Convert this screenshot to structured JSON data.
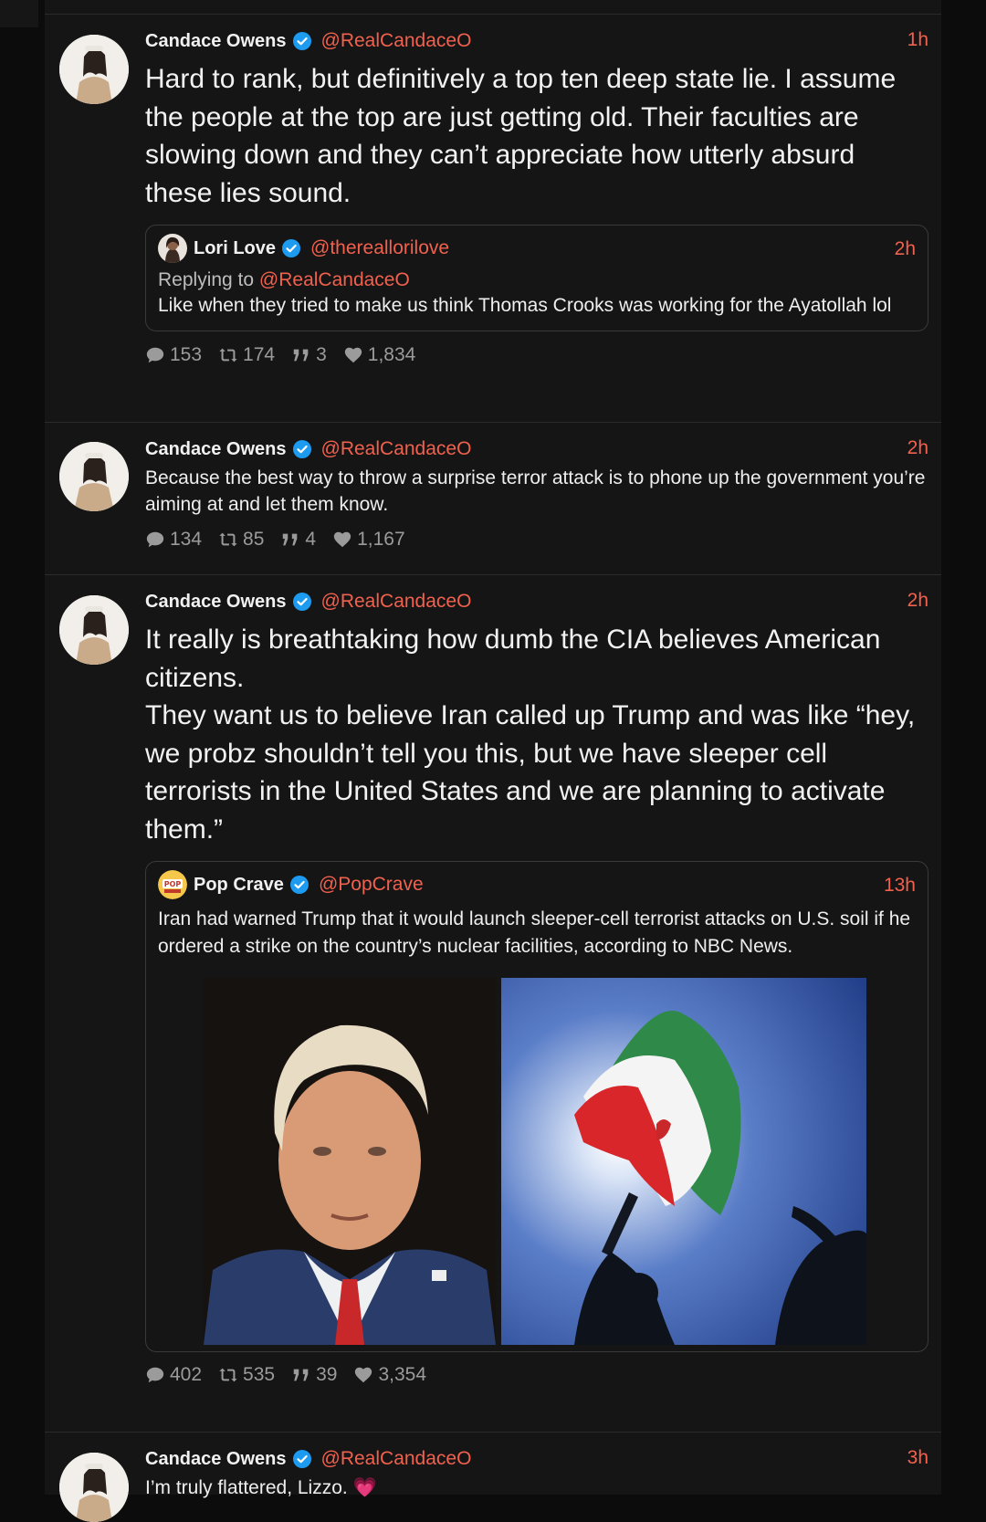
{
  "colors": {
    "accent": "#f0614e",
    "verified": "#1d9bf0",
    "background": "#151515"
  },
  "posts": [
    {
      "author": "Candace Owens",
      "handle": "@RealCandaceO",
      "time": "1h",
      "text": "Hard to rank, but definitively a top ten deep state lie. I assume the people at the top are just getting old. Their faculties are slowing down and they can’t appreciate how utterly absurd these lies sound.",
      "quote": {
        "author": "Lori Love",
        "handle": "@thereallorilove",
        "time": "2h",
        "replying_prefix": "Replying to",
        "replying_handle": "@RealCandaceO",
        "text": "Like when they tried to make us think Thomas Crooks was working for the Ayatollah lol"
      },
      "stats": {
        "replies": "153",
        "reposts": "174",
        "quotes": "3",
        "likes": "1,834"
      }
    },
    {
      "author": "Candace Owens",
      "handle": "@RealCandaceO",
      "time": "2h",
      "text": "Because the best way to throw a surprise terror attack is to phone up the government you’re aiming at and let them know.",
      "stats": {
        "replies": "134",
        "reposts": "85",
        "quotes": "4",
        "likes": "1,167"
      }
    },
    {
      "author": "Candace Owens",
      "handle": "@RealCandaceO",
      "time": "2h",
      "text": "It really is breathtaking how dumb the CIA believes American citizens.\nThey want us to believe Iran called up Trump and was like “hey, we probz shouldn’t tell you this, but we have sleeper cell terrorists in the United States and we are planning to activate them.”",
      "quote": {
        "author": "Pop Crave",
        "handle": "@PopCrave",
        "time": "13h",
        "text": "Iran had warned Trump that it would launch sleeper-cell terrorist attacks on U.S. soil if he ordered a strike on the country’s nuclear facilities, according to NBC News."
      },
      "stats": {
        "replies": "402",
        "reposts": "535",
        "quotes": "39",
        "likes": "3,354"
      }
    },
    {
      "author": "Candace Owens",
      "handle": "@RealCandaceO",
      "time": "3h",
      "text": "I’m truly flattered, Lizzo. 💗"
    }
  ]
}
